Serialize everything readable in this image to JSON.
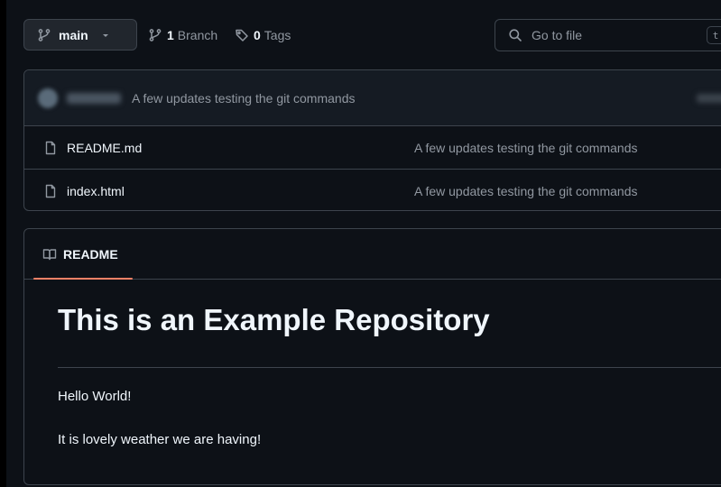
{
  "toolbar": {
    "branch_name": "main",
    "branch_count": "1",
    "branch_label": "Branch",
    "tag_count": "0",
    "tag_label": "Tags",
    "search_placeholder": "Go to file",
    "search_shortcut": "t"
  },
  "latest_commit": {
    "message": "A few updates testing the git commands"
  },
  "files": [
    {
      "name": "README.md",
      "commit": "A few updates testing the git commands",
      "icon": "file-icon"
    },
    {
      "name": "index.html",
      "commit": "A few updates testing the git commands",
      "icon": "file-icon"
    }
  ],
  "readme": {
    "tab_label": "README",
    "heading": "This is an Example Repository",
    "paragraphs": [
      "Hello World!",
      "It is lovely weather we are having!"
    ]
  },
  "colors": {
    "background": "#0d1117",
    "border": "#3d444d",
    "text": "#f0f6fc",
    "muted": "#9198a1",
    "tab_accent": "#f78166"
  }
}
